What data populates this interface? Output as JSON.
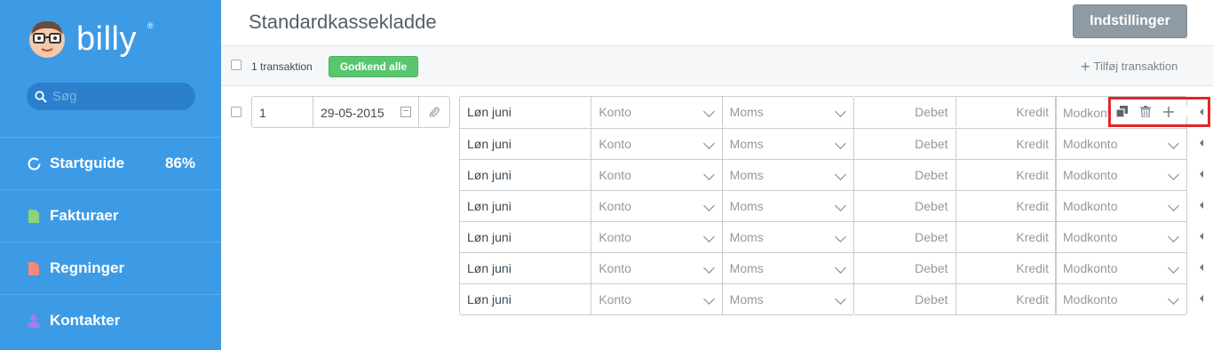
{
  "sidebar": {
    "brand": "billy",
    "brand_mark": "®",
    "search_placeholder": "Søg",
    "items": [
      {
        "label": "Startguide",
        "value": "86%",
        "icon": "progress-circle-icon"
      },
      {
        "label": "Fakturaer",
        "icon": "invoice-icon",
        "icon_color": "#8dd477"
      },
      {
        "label": "Regninger",
        "icon": "bill-icon",
        "icon_color": "#f08a7e"
      },
      {
        "label": "Kontakter",
        "icon": "contact-icon",
        "icon_color": "#a47ee8"
      }
    ]
  },
  "header": {
    "title": "Standardkassekladde",
    "settings_label": "Indstillinger"
  },
  "toolbar": {
    "count_label": "1 transaktion",
    "approve_label": "Godkend alle",
    "add_label": "Tilføj transaktion"
  },
  "transaction": {
    "number": "1",
    "date": "29-05-2015",
    "rows": [
      {
        "description": "Løn juni",
        "account": "Konto",
        "vat": "Moms",
        "debit": "Debet",
        "credit": "Kredit",
        "contra": "Modkonto"
      },
      {
        "description": "Løn juni",
        "account": "Konto",
        "vat": "Moms",
        "debit": "Debet",
        "credit": "Kredit",
        "contra": "Modkonto"
      },
      {
        "description": "Løn juni",
        "account": "Konto",
        "vat": "Moms",
        "debit": "Debet",
        "credit": "Kredit",
        "contra": "Modkonto"
      },
      {
        "description": "Løn juni",
        "account": "Konto",
        "vat": "Moms",
        "debit": "Debet",
        "credit": "Kredit",
        "contra": "Modkonto"
      },
      {
        "description": "Løn juni",
        "account": "Konto",
        "vat": "Moms",
        "debit": "Debet",
        "credit": "Kredit",
        "contra": "Modkonto"
      },
      {
        "description": "Løn juni",
        "account": "Konto",
        "vat": "Moms",
        "debit": "Debet",
        "credit": "Kredit",
        "contra": "Modkonto"
      },
      {
        "description": "Løn juni",
        "account": "Konto",
        "vat": "Moms",
        "debit": "Debet",
        "credit": "Kredit",
        "contra": "Modkonto"
      }
    ],
    "row_actions": [
      "copy-icon",
      "trash-icon",
      "plus-icon"
    ]
  },
  "colors": {
    "sidebar_bg": "#3d9be6",
    "approve_bg": "#58c66e",
    "settings_bg": "#8e9aa4",
    "highlight": "#e3262a"
  }
}
